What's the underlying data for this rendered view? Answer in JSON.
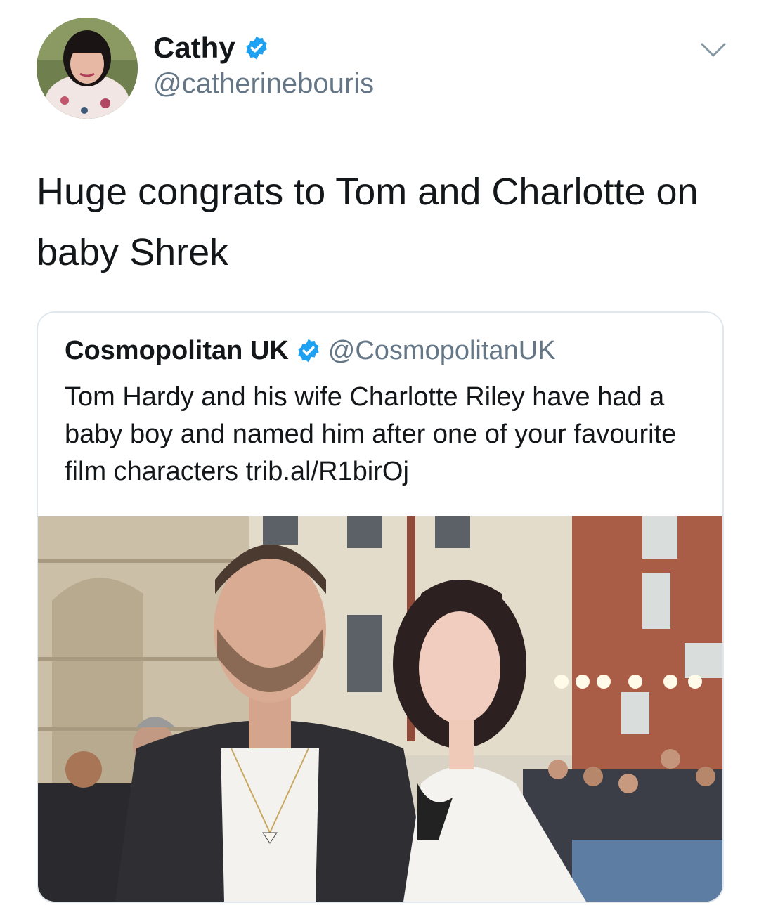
{
  "user": {
    "display_name": "Cathy",
    "handle": "@catherinebouris",
    "verified": true
  },
  "tweet": {
    "text": "Huge congrats to Tom and Charlotte on baby Shrek"
  },
  "quoted_tweet": {
    "display_name": "Cosmopolitan UK",
    "handle": "@CosmopolitanUK",
    "verified": true,
    "text": "Tom Hardy and his wife Charlotte Riley have had a baby boy and named him after one of your favourite film characters trib.al/R1birOj"
  },
  "icons": {
    "verified": "verified-badge-icon",
    "menu": "chevron-down-icon"
  },
  "colors": {
    "verified_blue": "#1da1f2",
    "text_primary": "#14171a",
    "text_secondary": "#657786",
    "card_border": "#e1e8ed"
  }
}
